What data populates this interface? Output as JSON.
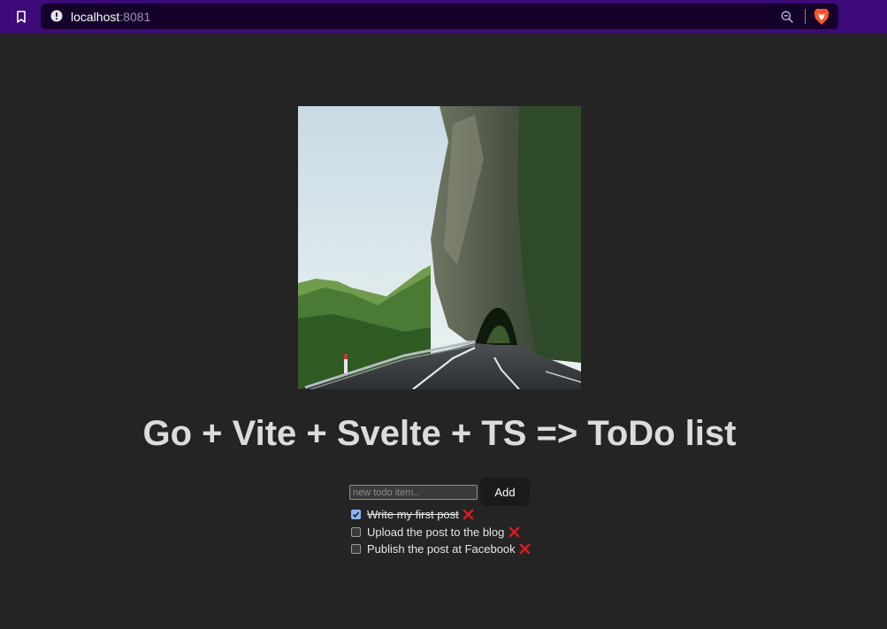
{
  "browser": {
    "url_host": "localhost",
    "url_port": ":8081",
    "icons": {
      "bookmark": "bookmark-icon",
      "info": "info-icon",
      "zoom": "zoom-out-icon",
      "brave": "brave-lion-icon"
    }
  },
  "page": {
    "title": "Go + Vite + Svelte + TS => ToDo list",
    "hero_image": "road-tunnel-mountain-photo"
  },
  "form": {
    "input_placeholder": "new todo item..",
    "input_value": "",
    "add_label": "Add"
  },
  "todos": [
    {
      "text": "Write my first post",
      "done": true
    },
    {
      "text": "Upload the post to the blog",
      "done": false
    },
    {
      "text": "Publish the post at Facebook",
      "done": false
    }
  ],
  "colors": {
    "browser_bar": "#3d0a7a",
    "page_background": "#242424",
    "delete_icon": "#e0171f"
  }
}
